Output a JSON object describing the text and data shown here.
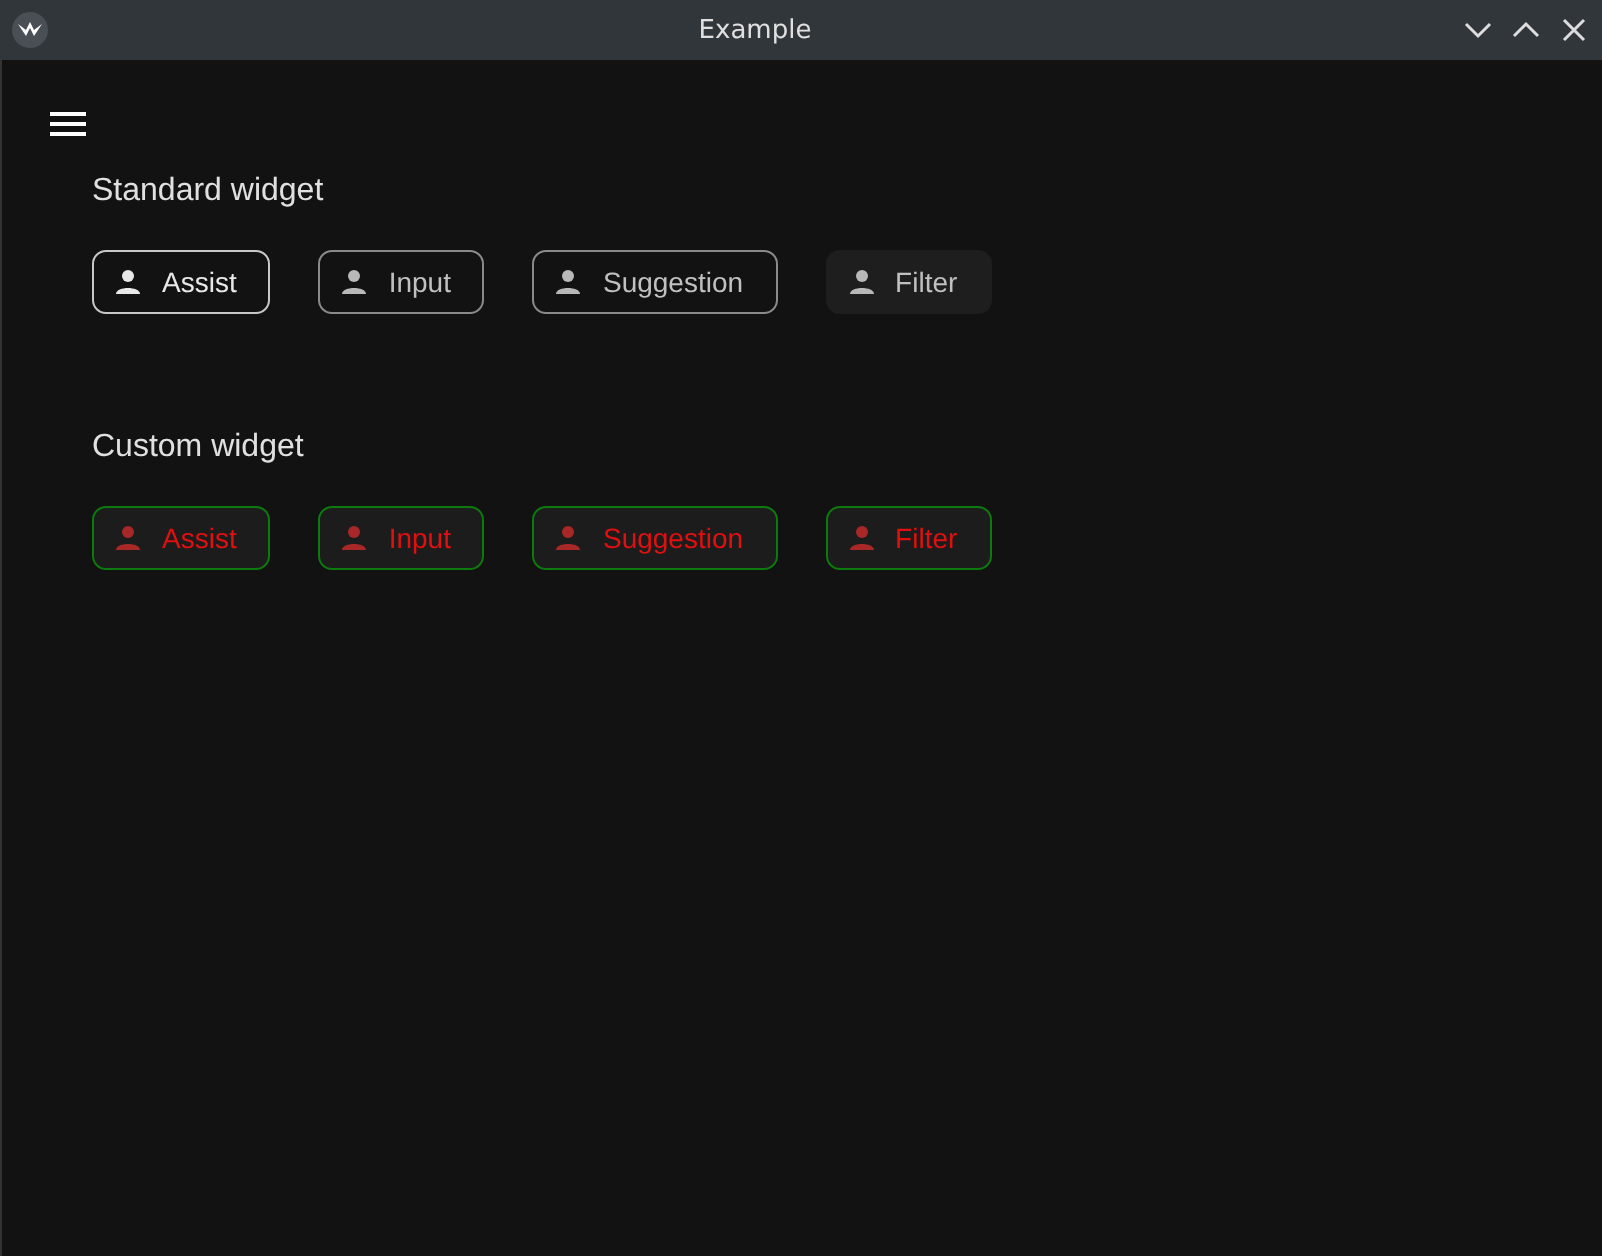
{
  "window": {
    "title": "Example"
  },
  "sections": [
    {
      "title": "Standard widget",
      "kind": "standard",
      "chips": [
        {
          "label": "Assist",
          "kind": "assist"
        },
        {
          "label": "Input",
          "kind": "input"
        },
        {
          "label": "Suggestion",
          "kind": "suggestion"
        },
        {
          "label": "Filter",
          "kind": "filter"
        }
      ]
    },
    {
      "title": "Custom widget",
      "kind": "custom",
      "chips": [
        {
          "label": "Assist",
          "kind": "assist"
        },
        {
          "label": "Input",
          "kind": "input"
        },
        {
          "label": "Suggestion",
          "kind": "suggestion"
        },
        {
          "label": "Filter",
          "kind": "filter"
        }
      ]
    }
  ]
}
